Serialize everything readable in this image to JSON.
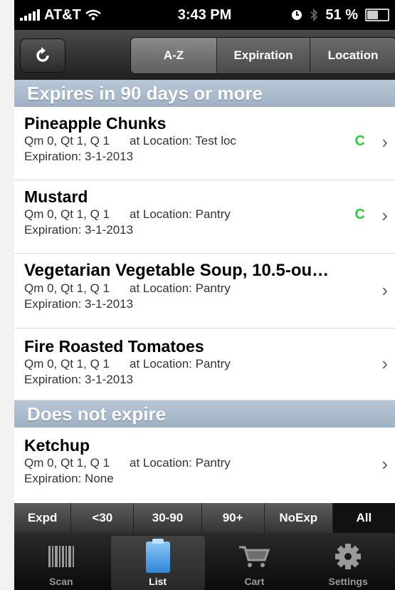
{
  "status": {
    "carrier": "AT&T",
    "time": "3:43 PM",
    "battery": "51 %"
  },
  "toolbar": {
    "refresh_icon": "refresh-icon",
    "segments": [
      "A-Z",
      "Expiration",
      "Location"
    ],
    "active_segment": 0
  },
  "sections": [
    {
      "title": "Expires in 90 days or more",
      "items": [
        {
          "name": "Pineapple Chunks",
          "qty": "Qm 0,  Qt 1, Q 1",
          "location": "at Location: Test loc",
          "expiration": "Expiration: 3-1-2013",
          "flag": "C"
        },
        {
          "name": "Mustard",
          "qty": "Qm 0,  Qt 1, Q 1",
          "location": "at Location: Pantry",
          "expiration": "Expiration: 3-1-2013",
          "flag": "C"
        },
        {
          "name": "Vegetarian Vegetable Soup, 10.5-ou…",
          "qty": "Qm 0,  Qt 1, Q 1",
          "location": "at Location: Pantry",
          "expiration": "Expiration: 3-1-2013",
          "flag": ""
        },
        {
          "name": "Fire Roasted Tomatoes",
          "qty": "Qm 0,  Qt 1, Q 1",
          "location": "at Location: Pantry",
          "expiration": "Expiration: 3-1-2013",
          "flag": ""
        }
      ]
    },
    {
      "title": "Does not expire",
      "items": [
        {
          "name": "Ketchup",
          "qty": "Qm 0,  Qt 1, Q 1",
          "location": "at Location: Pantry",
          "expiration": "Expiration: None",
          "flag": ""
        }
      ]
    }
  ],
  "filters": [
    "Expd",
    "<30",
    "30-90",
    "90+",
    "NoExp",
    "All"
  ],
  "tabs": [
    {
      "label": "Scan",
      "icon": "barcode-icon"
    },
    {
      "label": "List",
      "icon": "list-icon"
    },
    {
      "label": "Cart",
      "icon": "cart-icon"
    },
    {
      "label": "Settings",
      "icon": "gear-icon"
    }
  ],
  "colors": {
    "section": "#a9bacb",
    "flag": "#2ecc3a",
    "list_icon": "#4aa3e8"
  }
}
